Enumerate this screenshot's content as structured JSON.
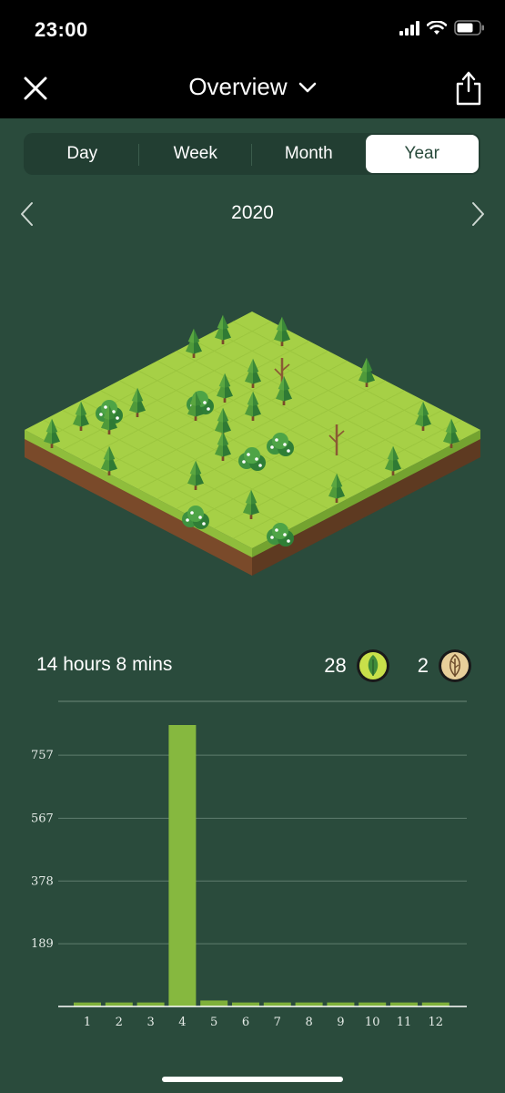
{
  "status_bar": {
    "time": "23:00"
  },
  "nav": {
    "title": "Overview"
  },
  "segments": [
    {
      "label": "Day",
      "active": false
    },
    {
      "label": "Week",
      "active": false
    },
    {
      "label": "Month",
      "active": false
    },
    {
      "label": "Year",
      "active": true
    }
  ],
  "period": {
    "label": "2020"
  },
  "summary": {
    "duration": "14 hours 8 mins",
    "healthy_trees": "28",
    "dead_trees": "2"
  },
  "colors": {
    "background": "#2a4b3c",
    "bar": "#8cc044",
    "healthy_badge": "#c8e04a",
    "dead_badge": "#e8cf9a"
  },
  "chart_data": {
    "type": "bar",
    "categories": [
      "1",
      "2",
      "3",
      "4",
      "5",
      "6",
      "7",
      "8",
      "9",
      "10",
      "11",
      "12"
    ],
    "values": [
      12,
      12,
      12,
      848,
      18,
      12,
      12,
      12,
      12,
      12,
      12,
      12
    ],
    "y_ticks": [
      189,
      378,
      567,
      757
    ],
    "ylim": [
      0,
      848
    ],
    "grid": true,
    "title": "",
    "xlabel": "",
    "ylabel": ""
  }
}
